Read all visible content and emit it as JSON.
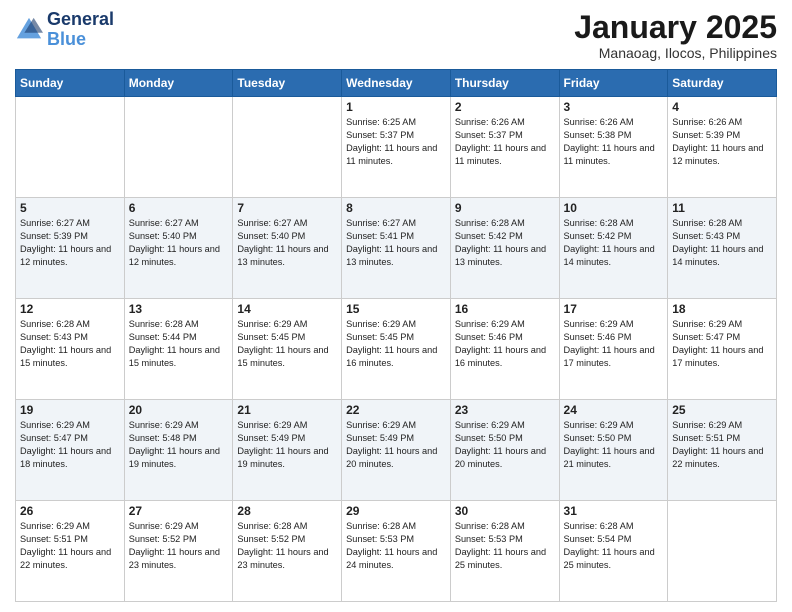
{
  "header": {
    "logo_line1": "General",
    "logo_line2": "Blue",
    "month": "January 2025",
    "location": "Manaoag, Ilocos, Philippines"
  },
  "weekdays": [
    "Sunday",
    "Monday",
    "Tuesday",
    "Wednesday",
    "Thursday",
    "Friday",
    "Saturday"
  ],
  "weeks": [
    [
      {
        "day": "",
        "info": ""
      },
      {
        "day": "",
        "info": ""
      },
      {
        "day": "",
        "info": ""
      },
      {
        "day": "1",
        "info": "Sunrise: 6:25 AM\nSunset: 5:37 PM\nDaylight: 11 hours and 11 minutes."
      },
      {
        "day": "2",
        "info": "Sunrise: 6:26 AM\nSunset: 5:37 PM\nDaylight: 11 hours and 11 minutes."
      },
      {
        "day": "3",
        "info": "Sunrise: 6:26 AM\nSunset: 5:38 PM\nDaylight: 11 hours and 11 minutes."
      },
      {
        "day": "4",
        "info": "Sunrise: 6:26 AM\nSunset: 5:39 PM\nDaylight: 11 hours and 12 minutes."
      }
    ],
    [
      {
        "day": "5",
        "info": "Sunrise: 6:27 AM\nSunset: 5:39 PM\nDaylight: 11 hours and 12 minutes."
      },
      {
        "day": "6",
        "info": "Sunrise: 6:27 AM\nSunset: 5:40 PM\nDaylight: 11 hours and 12 minutes."
      },
      {
        "day": "7",
        "info": "Sunrise: 6:27 AM\nSunset: 5:40 PM\nDaylight: 11 hours and 13 minutes."
      },
      {
        "day": "8",
        "info": "Sunrise: 6:27 AM\nSunset: 5:41 PM\nDaylight: 11 hours and 13 minutes."
      },
      {
        "day": "9",
        "info": "Sunrise: 6:28 AM\nSunset: 5:42 PM\nDaylight: 11 hours and 13 minutes."
      },
      {
        "day": "10",
        "info": "Sunrise: 6:28 AM\nSunset: 5:42 PM\nDaylight: 11 hours and 14 minutes."
      },
      {
        "day": "11",
        "info": "Sunrise: 6:28 AM\nSunset: 5:43 PM\nDaylight: 11 hours and 14 minutes."
      }
    ],
    [
      {
        "day": "12",
        "info": "Sunrise: 6:28 AM\nSunset: 5:43 PM\nDaylight: 11 hours and 15 minutes."
      },
      {
        "day": "13",
        "info": "Sunrise: 6:28 AM\nSunset: 5:44 PM\nDaylight: 11 hours and 15 minutes."
      },
      {
        "day": "14",
        "info": "Sunrise: 6:29 AM\nSunset: 5:45 PM\nDaylight: 11 hours and 15 minutes."
      },
      {
        "day": "15",
        "info": "Sunrise: 6:29 AM\nSunset: 5:45 PM\nDaylight: 11 hours and 16 minutes."
      },
      {
        "day": "16",
        "info": "Sunrise: 6:29 AM\nSunset: 5:46 PM\nDaylight: 11 hours and 16 minutes."
      },
      {
        "day": "17",
        "info": "Sunrise: 6:29 AM\nSunset: 5:46 PM\nDaylight: 11 hours and 17 minutes."
      },
      {
        "day": "18",
        "info": "Sunrise: 6:29 AM\nSunset: 5:47 PM\nDaylight: 11 hours and 17 minutes."
      }
    ],
    [
      {
        "day": "19",
        "info": "Sunrise: 6:29 AM\nSunset: 5:47 PM\nDaylight: 11 hours and 18 minutes."
      },
      {
        "day": "20",
        "info": "Sunrise: 6:29 AM\nSunset: 5:48 PM\nDaylight: 11 hours and 19 minutes."
      },
      {
        "day": "21",
        "info": "Sunrise: 6:29 AM\nSunset: 5:49 PM\nDaylight: 11 hours and 19 minutes."
      },
      {
        "day": "22",
        "info": "Sunrise: 6:29 AM\nSunset: 5:49 PM\nDaylight: 11 hours and 20 minutes."
      },
      {
        "day": "23",
        "info": "Sunrise: 6:29 AM\nSunset: 5:50 PM\nDaylight: 11 hours and 20 minutes."
      },
      {
        "day": "24",
        "info": "Sunrise: 6:29 AM\nSunset: 5:50 PM\nDaylight: 11 hours and 21 minutes."
      },
      {
        "day": "25",
        "info": "Sunrise: 6:29 AM\nSunset: 5:51 PM\nDaylight: 11 hours and 22 minutes."
      }
    ],
    [
      {
        "day": "26",
        "info": "Sunrise: 6:29 AM\nSunset: 5:51 PM\nDaylight: 11 hours and 22 minutes."
      },
      {
        "day": "27",
        "info": "Sunrise: 6:29 AM\nSunset: 5:52 PM\nDaylight: 11 hours and 23 minutes."
      },
      {
        "day": "28",
        "info": "Sunrise: 6:28 AM\nSunset: 5:52 PM\nDaylight: 11 hours and 23 minutes."
      },
      {
        "day": "29",
        "info": "Sunrise: 6:28 AM\nSunset: 5:53 PM\nDaylight: 11 hours and 24 minutes."
      },
      {
        "day": "30",
        "info": "Sunrise: 6:28 AM\nSunset: 5:53 PM\nDaylight: 11 hours and 25 minutes."
      },
      {
        "day": "31",
        "info": "Sunrise: 6:28 AM\nSunset: 5:54 PM\nDaylight: 11 hours and 25 minutes."
      },
      {
        "day": "",
        "info": ""
      }
    ]
  ]
}
